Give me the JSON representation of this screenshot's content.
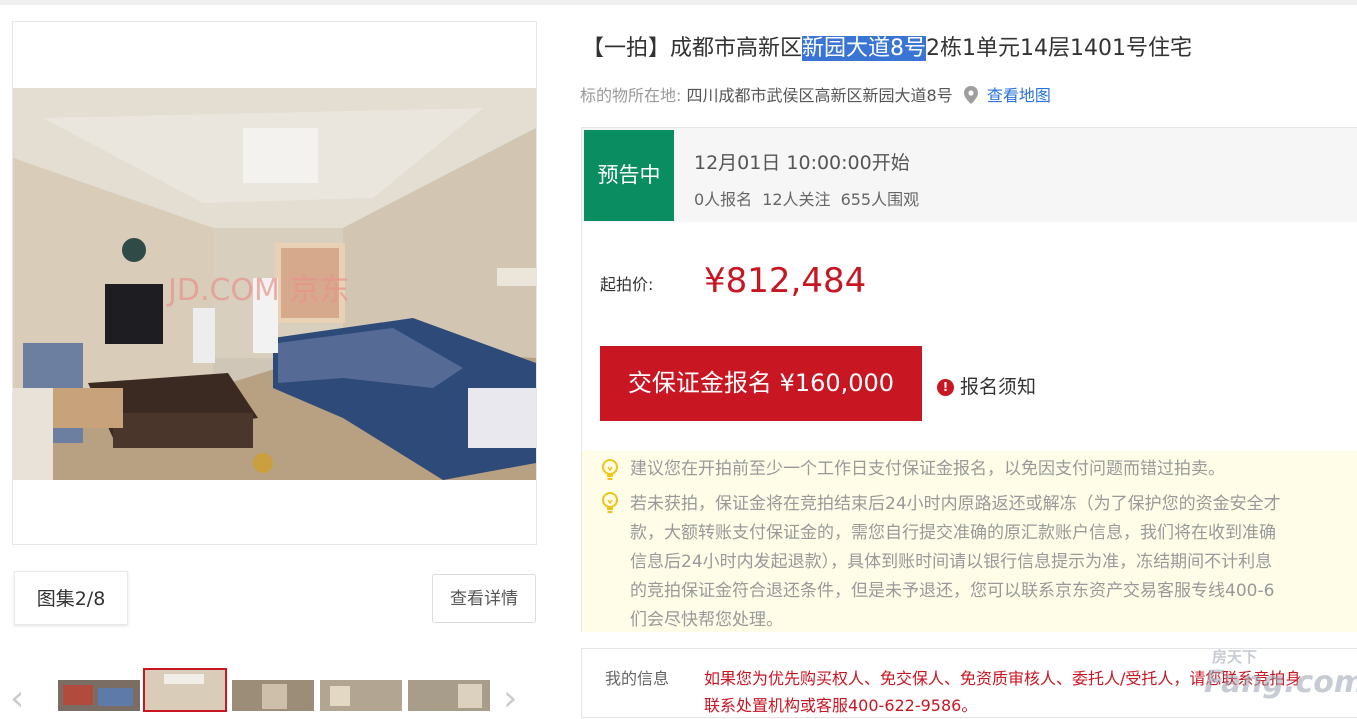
{
  "gallery": {
    "counter": "图集2/8",
    "detail_button": "查看详情",
    "photo_watermark": "JD.COM 京东",
    "thumbnails": 5,
    "active_thumbnail": 2
  },
  "listing": {
    "title_prefix": "【一拍】成都市高新区",
    "title_highlight": "新园大道8号",
    "title_suffix": "2栋1单元14层1401号住宅",
    "location_label": "标的物所在地:",
    "location_address": "四川成都市武侯区高新区新园大道8号",
    "map_link": "查看地图"
  },
  "auction": {
    "status": "预告中",
    "start_time": "12月01日 10:00:00开始",
    "signups": "0人报名",
    "followers": "12人关注",
    "viewers": "655人围观",
    "price_label": "起拍价:",
    "price": "¥812,484",
    "deposit_button": "交保证金报名 ¥160,000",
    "notice_link": "报名须知",
    "status_color": "#0b8d62",
    "accent_color": "#c81623"
  },
  "tips": {
    "tip1": "建议您在开拍前至少一个工作日支付保证金报名，以免因支付问题而错过拍卖。",
    "tip2_line1": "若未获拍，保证金将在竞拍结束后24小时内原路返还或解冻（为了保护您的资金安全才",
    "tip2_line2": "款，大额转账支付保证金的，需您自行提交准确的原汇款账户信息，我们将在收到准确",
    "tip2_line3": "信息后24小时内发起退款），具体到账时间请以银行信息提示为准，冻结期间不计利息",
    "tip2_line4": "的竞拍保证金符合退还条件，但是未予退还，您可以联系京东资产交易客服专线400-6",
    "tip2_line5": "们会尽快帮您处理。"
  },
  "my_info": {
    "label": "我的信息",
    "line1": "如果您为优先购买权人、免交保人、免资质审核人、委托人/受托人，请您联系竞拍身",
    "line2": "联系处置机构或客服400-622-9586。"
  },
  "watermark": "房天下 Fang.com"
}
